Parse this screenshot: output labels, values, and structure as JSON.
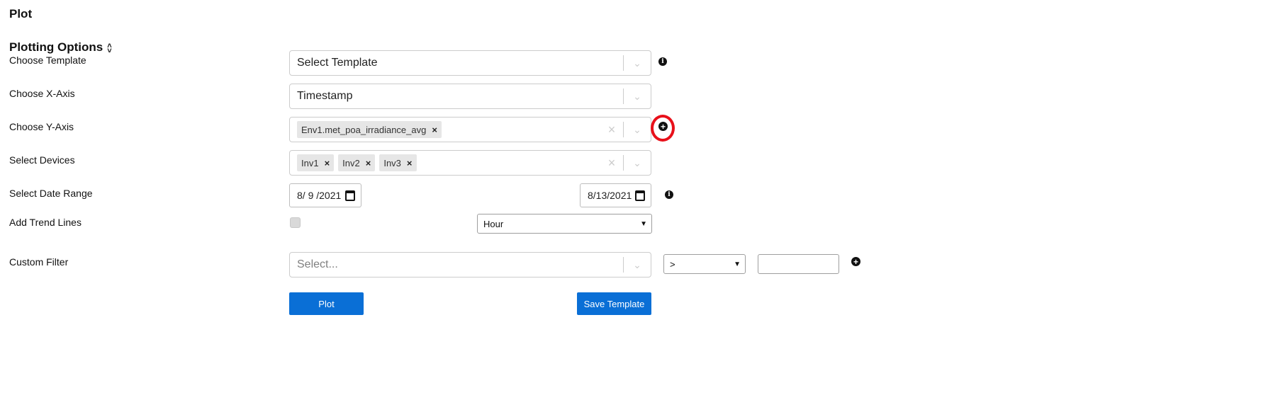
{
  "page": {
    "title": "Plot"
  },
  "plotting_options": {
    "title": "Plotting Options",
    "labels": {
      "template": "Choose Template",
      "x_axis": "Choose X-Axis",
      "y_axis": "Choose Y-Axis",
      "devices": "Select Devices",
      "date_range": "Select Date Range",
      "trend_lines": "Add Trend Lines",
      "custom_filter": "Custom Filter"
    },
    "template_select": {
      "value": "Select Template"
    },
    "x_axis_select": {
      "value": "Timestamp"
    },
    "y_axis_select": {
      "chips": [
        "Env1.met_poa_irradiance_avg"
      ]
    },
    "devices_select": {
      "chips": [
        "Inv1",
        "Inv2",
        "Inv3"
      ]
    },
    "date_range": {
      "start": "8/ 9 /2021",
      "end": "8/13/2021"
    },
    "trend_lines": {
      "checked": false,
      "interval": "Hour"
    },
    "custom_filter": {
      "placeholder": "Select...",
      "operator": ">",
      "value": ""
    },
    "buttons": {
      "plot": "Plot",
      "save_template": "Save Template"
    }
  },
  "icons": {
    "info": "info-icon",
    "add": "plus-circle-icon",
    "dropdown": "chevron-down-icon",
    "clear": "clear-x-icon",
    "calendar": "calendar-icon",
    "collapse": "collapse-chevrons-icon"
  },
  "colors": {
    "accent": "#0a6fd6",
    "highlight_ring": "#e8101a"
  }
}
